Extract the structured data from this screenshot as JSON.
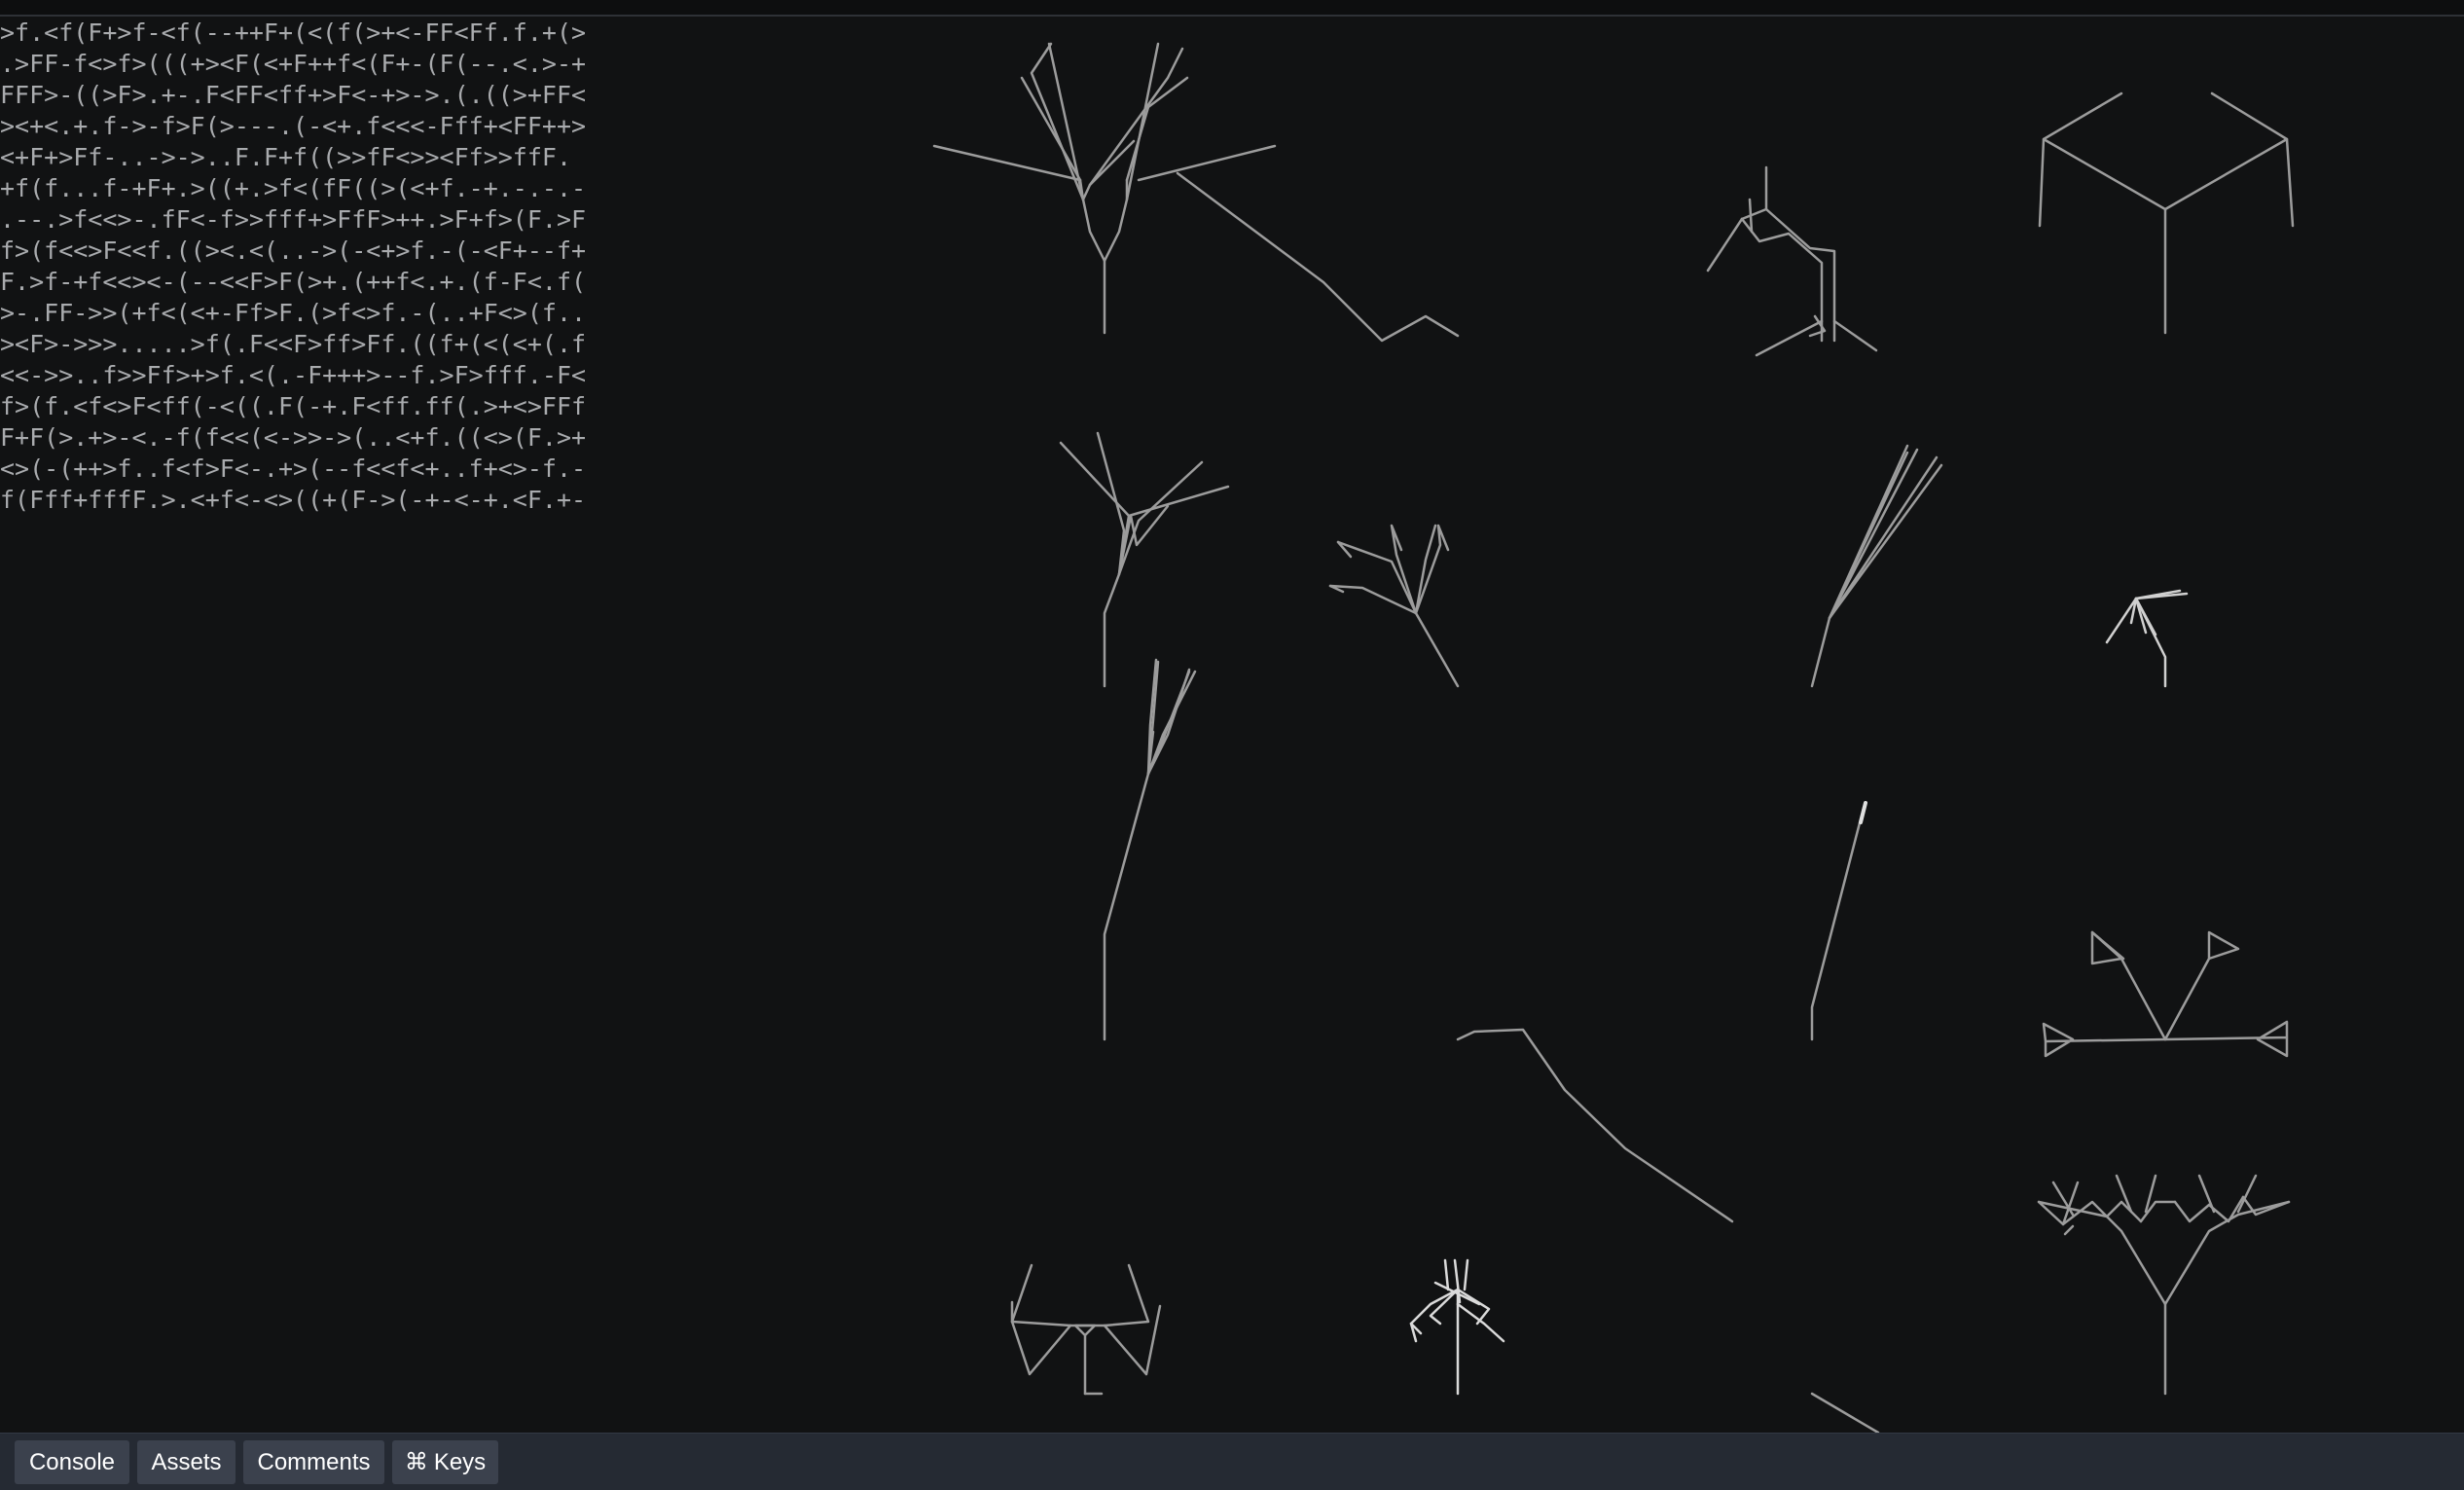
{
  "code_lines": [
    ">f.<f(F+>f-<f(--++F+(<(f(>+<-FF<Ff.f.+(>",
    ".>FF-f<>f>(((+><F(<+F++f<(F+-(F(--.<.>-+",
    "FFF>-((>F>.+-.F<FF<ff+>F<-+>->.(.((>+FF<",
    "><+<.+.f->-f>F(>---.(-<+.f<<<-Fff+<FF++>",
    "<+F+>Ff-..->->..F.F+f((>>fF<>><Ff>>ffF.",
    "+f(f...f-+F+.>((+.>f<(fF((>(<+f.-+.-.-.-",
    ".--.>f<<>-.fF<-f>>fff+>FfF>++.>F+f>(F.>F",
    "f>(f<<>F<<f.((><.<(..->(-<+>f.-(-<F+--f+",
    "F.>f-+f<<><-(--<<F>F(>+.(++f<.+.(f-F<.f(",
    ">-.FF->>(+f<(<+-Ff>F.(>f<>f.-(..+F<>(f..",
    "><F>->>>.....>f(.F<<F>ff>Ff.((f+(<(<+(.f",
    "<<->>..f>>Ff>+>f.<(.-F+++>--f.>F>fff.-F<",
    "f>(f.<f<>F<ff(-<((.F(-+.F<ff.ff(.>+<>FFf",
    "F+F(>.+>-<.-f(f<<(<->>->(..<+f.((<>(F.>+",
    "<>(-(++>f..f<f>F<-.+>(--f<<f<+..f+<>-f.-",
    "f(Fff+fffF.>.<+f<-<>((+(F->(-+-<-+.<F.+-"
  ],
  "bottom_tabs": {
    "console": "Console",
    "assets": "Assets",
    "comments": "Comments",
    "keys_symbol": "⌘",
    "keys": "Keys"
  },
  "colors": {
    "background": "#111213",
    "code_text": "#a9abae",
    "stroke": "#9c9c9c",
    "bottom_bar": "#252a33",
    "tab_button": "#3b414d"
  }
}
